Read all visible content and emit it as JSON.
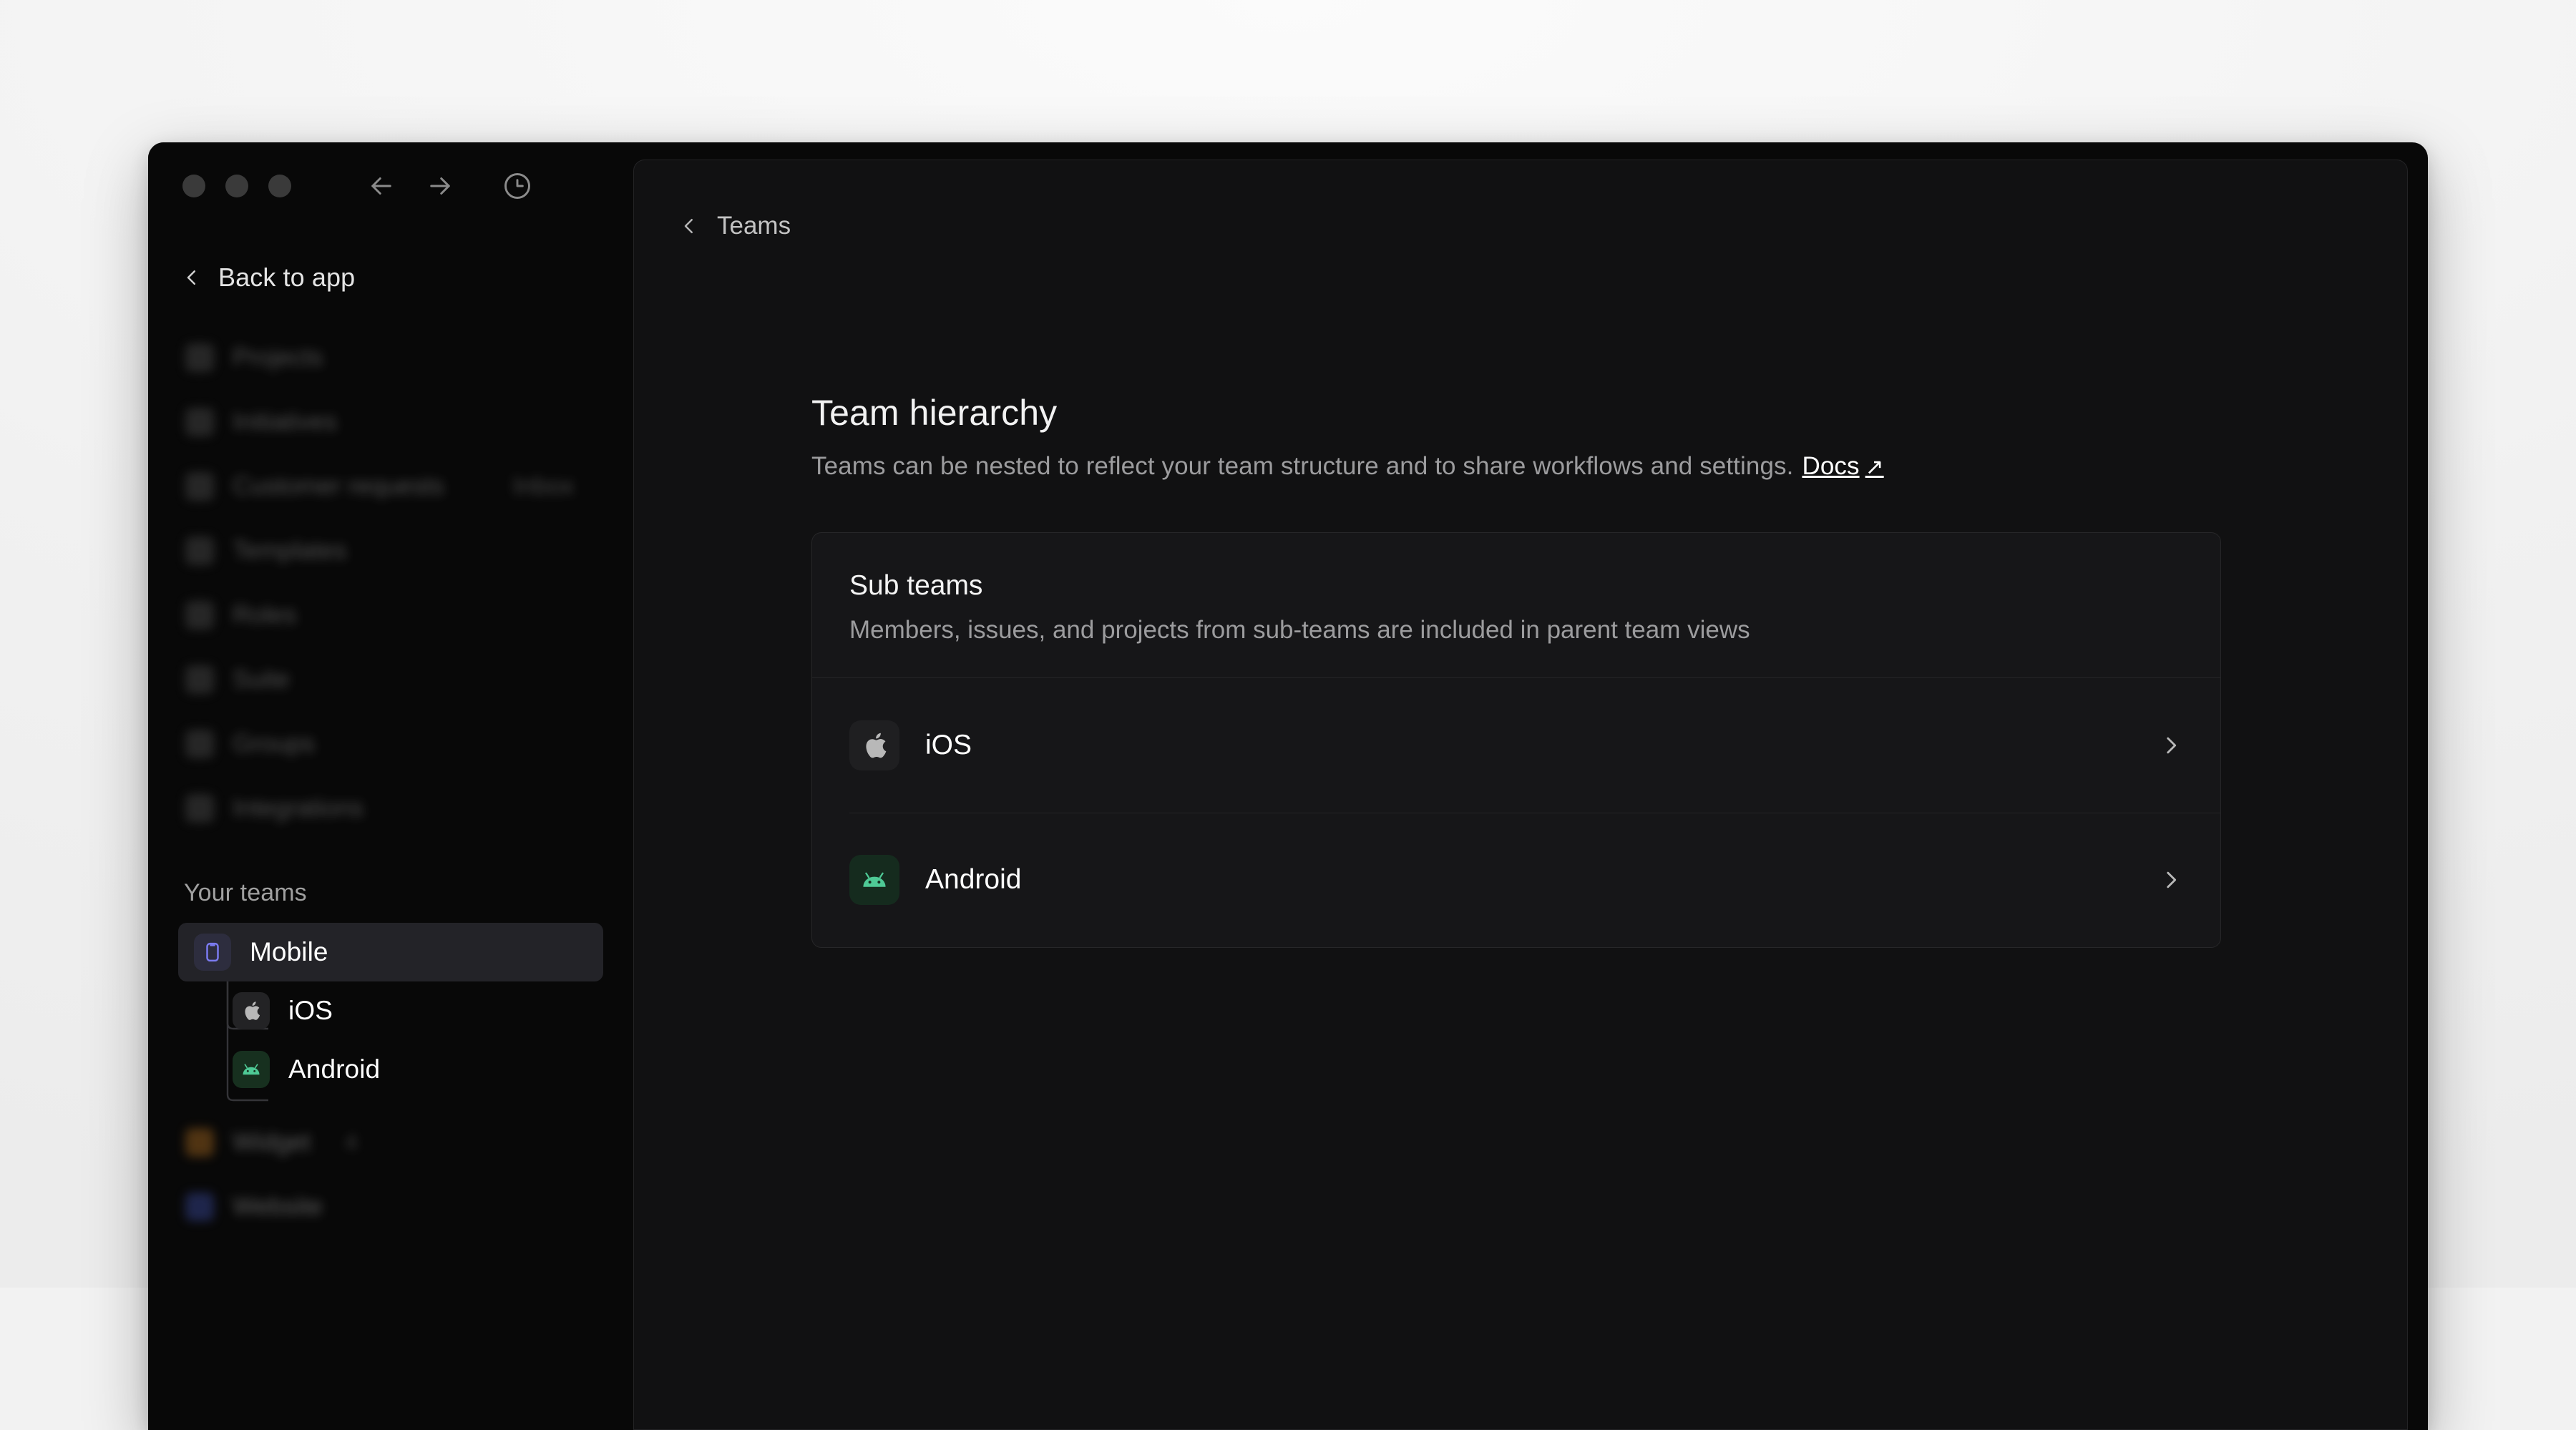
{
  "window": {
    "titlebar": {
      "traffic_lights": [
        "close",
        "minimize",
        "maximize"
      ],
      "back_label": "back-arrow",
      "forward_label": "forward-arrow",
      "history_label": "clock"
    },
    "back_to_app": "Back to app"
  },
  "sidebar": {
    "nav_items": [
      {
        "label": "Projects"
      },
      {
        "label": "Initiatives"
      },
      {
        "label": "Customer requests",
        "count": ""
      },
      {
        "label": "Templates"
      },
      {
        "label": "Roles"
      },
      {
        "label": "Suite"
      },
      {
        "label": "Groups"
      },
      {
        "label": "Integrations"
      }
    ],
    "teams_label": "Your teams",
    "teams": [
      {
        "label": "Mobile",
        "icon": "phone-icon",
        "selected": true
      },
      {
        "label": "iOS",
        "icon": "apple-icon",
        "child": true
      },
      {
        "label": "Android",
        "icon": "android-icon",
        "child": true
      }
    ],
    "more_teams": [
      {
        "label": "Widget",
        "count": "4",
        "icon": "widget-icon"
      },
      {
        "label": "Website",
        "count": "",
        "icon": "website-icon"
      }
    ]
  },
  "breadcrumb": {
    "back_icon": "chevron-left-icon",
    "label": "Teams"
  },
  "main": {
    "heading": "Team hierarchy",
    "description": "Teams can be nested to reflect your team structure and to share workflows and settings.",
    "docs_label": "Docs",
    "docs_arrow": "↗",
    "card": {
      "title": "Sub teams",
      "description": "Members, issues, and projects from sub-teams are included in parent team views",
      "rows": [
        {
          "label": "iOS",
          "icon": "apple-icon",
          "chevron": "chevron-right-icon"
        },
        {
          "label": "Android",
          "icon": "android-icon",
          "chevron": "chevron-right-icon"
        }
      ]
    }
  },
  "colors": {
    "page_background": "#f2f2f2",
    "window_background": "#080808",
    "panel_background": "#111112",
    "card_background": "#161618",
    "selected_row": "#232328",
    "accent_indigo": "#7b7bf0",
    "android_green": "#4ec995",
    "text_primary": "#ffffff",
    "text_secondary": "#9c9c9e"
  }
}
